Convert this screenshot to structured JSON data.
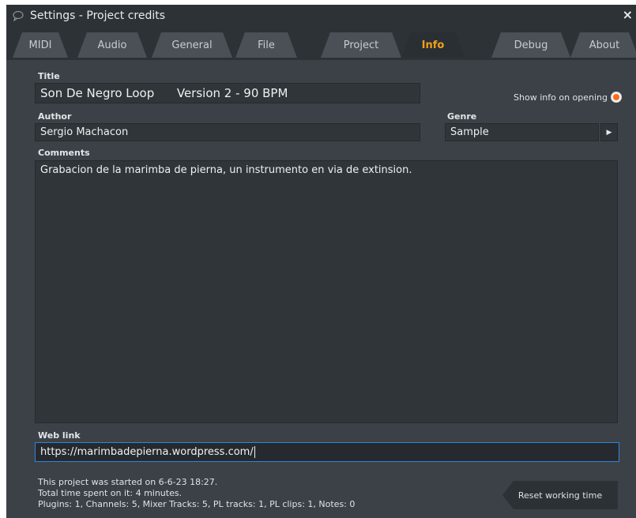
{
  "window": {
    "title": "Settings - Project credits",
    "close_label": "×"
  },
  "tabs": [
    {
      "label": "MIDI"
    },
    {
      "label": "Audio"
    },
    {
      "label": "General"
    },
    {
      "label": "File"
    },
    {
      "label": "Project"
    },
    {
      "label": "Info",
      "active": true
    },
    {
      "label": "Debug"
    },
    {
      "label": "About"
    }
  ],
  "info": {
    "title_label": "Title",
    "title_value": "Son De Negro Loop      Version 2 - 90 BPM",
    "show_info_label": "Show info on opening",
    "show_info_checked": true,
    "author_label": "Author",
    "author_value": "Sergio Machacon",
    "genre_label": "Genre",
    "genre_value": "Sample",
    "comments_label": "Comments",
    "comments_value": "Grabacion de la marimba de pierna, un instrumento en via de extinsion.",
    "weblink_label": "Web link",
    "weblink_value": "https://marimbadepierna.wordpress.com/",
    "started": "This project was started on 6-6-23 18:27.",
    "time_spent": "Total time spent on it:  4 minutes.",
    "stats": "Plugins: 1, Channels: 5, Mixer Tracks: 5, PL tracks: 1, PL clips: 1, Notes: 0",
    "reset_label": "Reset working time"
  },
  "colors": {
    "accent": "#f4a019",
    "radio_on": "#ff6a1a",
    "focus_border": "#2f86d6"
  },
  "icons": {
    "title_icon": "speech-bubble-icon",
    "genre_arrow": "arrow-right-icon"
  }
}
